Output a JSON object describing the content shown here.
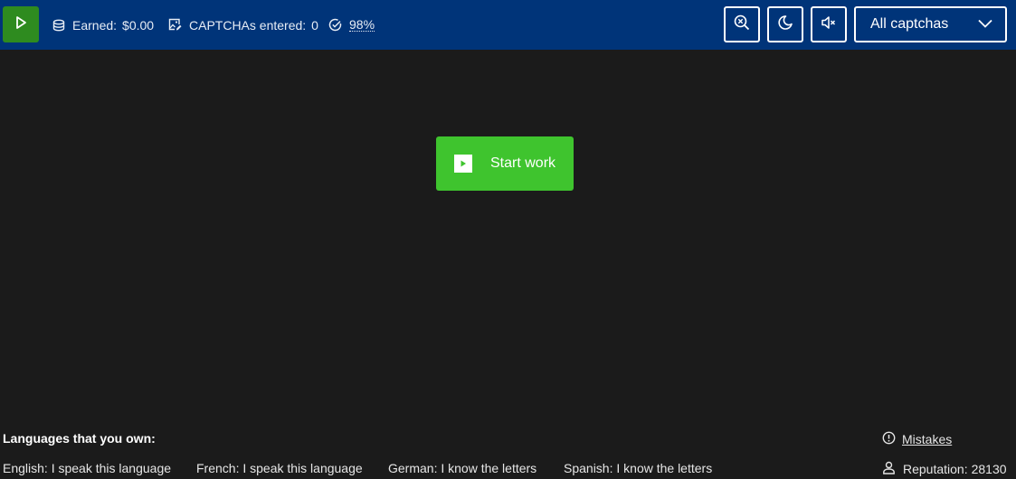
{
  "topbar": {
    "earned_label": "Earned:",
    "earned_value": "$0.00",
    "entered_label": "CAPTCHAs entered:",
    "entered_value": "0",
    "accuracy_value": "98%",
    "select_value": "All captchas",
    "icons": {
      "play": "play-icon",
      "earned": "coins-icon",
      "entered": "image-edit-icon",
      "accuracy": "check-circle-icon",
      "zoom": "zoom-reset-icon",
      "theme": "moon-icon",
      "sound": "sound-mute-icon",
      "select": "chevron-down-icon"
    }
  },
  "main": {
    "start_label": "Start work"
  },
  "footer": {
    "languages_title": "Languages that you own:",
    "languages": [
      "English: I speak this language",
      "French: I speak this language",
      "German: I know the letters",
      "Spanish: I know the letters"
    ],
    "mistakes_label": "Mistakes",
    "reputation_label": "Reputation:",
    "reputation_value": "28130"
  },
  "colors": {
    "topbar": "#003479",
    "background": "#1b1b1b",
    "play_button": "#2e8b1f",
    "start_button": "#3fc42e"
  }
}
